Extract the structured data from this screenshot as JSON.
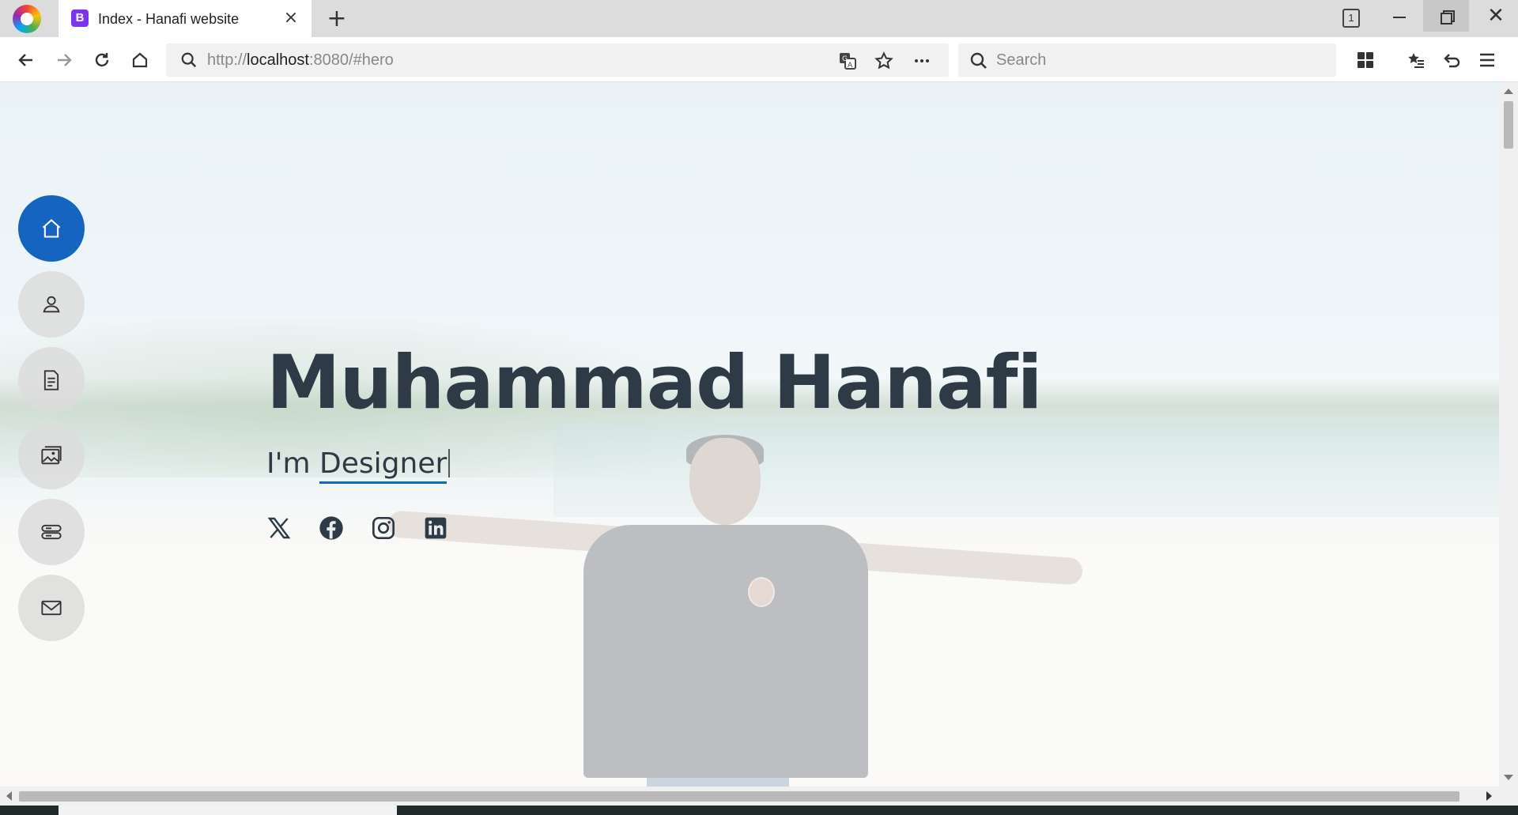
{
  "browser": {
    "tab": {
      "favicon_letter": "B",
      "title": "Index - Hanafi website",
      "close": "×"
    },
    "new_tab": "+",
    "tab_count": "1",
    "window_close": "✕",
    "url": {
      "scheme": "http://",
      "host": "localhost",
      "rest": ":8080/#hero"
    },
    "search": {
      "placeholder": "Search"
    }
  },
  "page": {
    "nav": [
      {
        "name": "home",
        "icon": "house-icon",
        "active": true
      },
      {
        "name": "about",
        "icon": "person-icon",
        "active": false
      },
      {
        "name": "resume",
        "icon": "file-text-icon",
        "active": false
      },
      {
        "name": "portfolio",
        "icon": "images-icon",
        "active": false
      },
      {
        "name": "services",
        "icon": "server-icon",
        "active": false
      },
      {
        "name": "contact",
        "icon": "envelope-icon",
        "active": false
      }
    ],
    "hero": {
      "title": "Muhammad Hanafi",
      "subtitle_prefix": "I'm",
      "typed_word": "Designer"
    },
    "socials": [
      {
        "name": "x",
        "icon": "x-twitter-icon"
      },
      {
        "name": "facebook",
        "icon": "facebook-icon"
      },
      {
        "name": "instagram",
        "icon": "instagram-icon"
      },
      {
        "name": "linkedin",
        "icon": "linkedin-icon"
      }
    ],
    "colors": {
      "accent": "#1565c0",
      "text": "#2e3b46"
    }
  }
}
